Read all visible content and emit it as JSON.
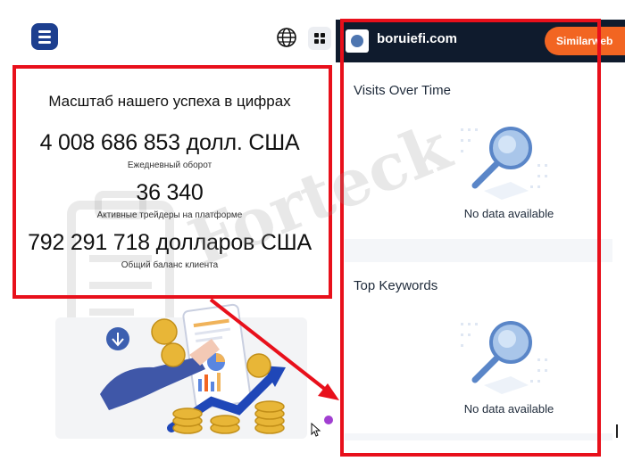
{
  "left_page": {
    "stats": {
      "title": "Масштаб нашего успеха в цифрах",
      "items": [
        {
          "value": "4 008 686 853 долл. США",
          "label": "Ежедневный оборот"
        },
        {
          "value": "36 340",
          "label": "Активные трейдеры на платформе"
        },
        {
          "value": "792 291 718 долларов США",
          "label": "Общий баланс клиента"
        }
      ]
    }
  },
  "similarweb_panel": {
    "site_name": "boruiefi.com",
    "brand_button": "Similarweb",
    "sections": [
      {
        "title": "Visits Over Time",
        "empty_text": "No data available"
      },
      {
        "title": "Top Keywords",
        "empty_text": "No data available"
      }
    ]
  },
  "watermark": {
    "text": "Forteck"
  },
  "colors": {
    "highlight_red": "#e8101b",
    "header_navy": "#0f1b2d",
    "brand_orange": "#f26522",
    "logo_blue": "#1d3f8f"
  },
  "icons": [
    "app-logo-icon",
    "globe-icon",
    "grid-menu-icon",
    "site-favicon-icon",
    "magnifier-empty-icon",
    "cursor-icon"
  ]
}
